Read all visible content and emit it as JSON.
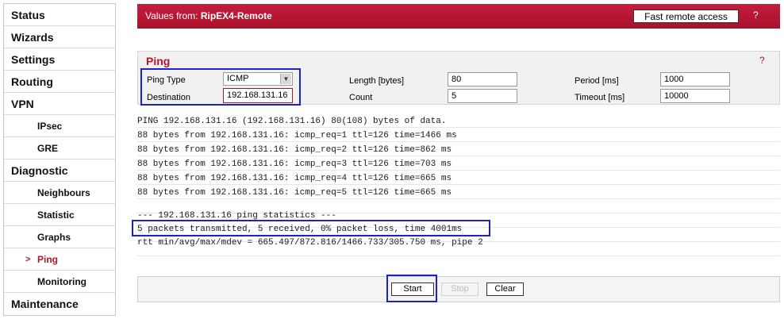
{
  "sidebar": {
    "items": [
      {
        "label": "Status"
      },
      {
        "label": "Wizards"
      },
      {
        "label": "Settings"
      },
      {
        "label": "Routing"
      },
      {
        "label": "VPN"
      },
      {
        "label": "IPsec"
      },
      {
        "label": "GRE"
      },
      {
        "label": "Diagnostic"
      },
      {
        "label": "Neighbours"
      },
      {
        "label": "Statistic"
      },
      {
        "label": "Graphs"
      },
      {
        "label": "Ping",
        "active": true
      },
      {
        "label": "Monitoring"
      },
      {
        "label": "Maintenance"
      }
    ],
    "active_marker": ">"
  },
  "header": {
    "prefix": "Values from: ",
    "device": "RipEX4-Remote",
    "fast_access_label": "Fast remote access",
    "help": "?"
  },
  "ping": {
    "title": "Ping",
    "help": "?",
    "ping_type_label": "Ping Type",
    "ping_type_value": "ICMP",
    "destination_label": "Destination",
    "destination_value": "192.168.131.16",
    "length_label": "Length [bytes]",
    "length_value": "80",
    "count_label": "Count",
    "count_value": "5",
    "period_label": "Period [ms]",
    "period_value": "1000",
    "timeout_label": "Timeout [ms]",
    "timeout_value": "10000"
  },
  "output": {
    "lines": [
      "PING 192.168.131.16 (192.168.131.16) 80(108) bytes of data.",
      "88 bytes from 192.168.131.16: icmp_req=1 ttl=126 time=1466 ms",
      "88 bytes from 192.168.131.16: icmp_req=2 ttl=126 time=862 ms",
      "88 bytes from 192.168.131.16: icmp_req=3 ttl=126 time=703 ms",
      "88 bytes from 192.168.131.16: icmp_req=4 ttl=126 time=665 ms",
      "88 bytes from 192.168.131.16: icmp_req=5 ttl=126 time=665 ms",
      "",
      "--- 192.168.131.16 ping statistics ---",
      "5 packets transmitted, 5 received, 0% packet loss, time 4001ms",
      "rtt min/avg/max/mdev = 665.497/872.816/1466.733/305.750 ms, pipe 2"
    ]
  },
  "buttons": {
    "start": "Start",
    "stop": "Stop",
    "clear": "Clear"
  },
  "colors": {
    "brand": "#b0152b",
    "highlight": "#1a22c8"
  }
}
